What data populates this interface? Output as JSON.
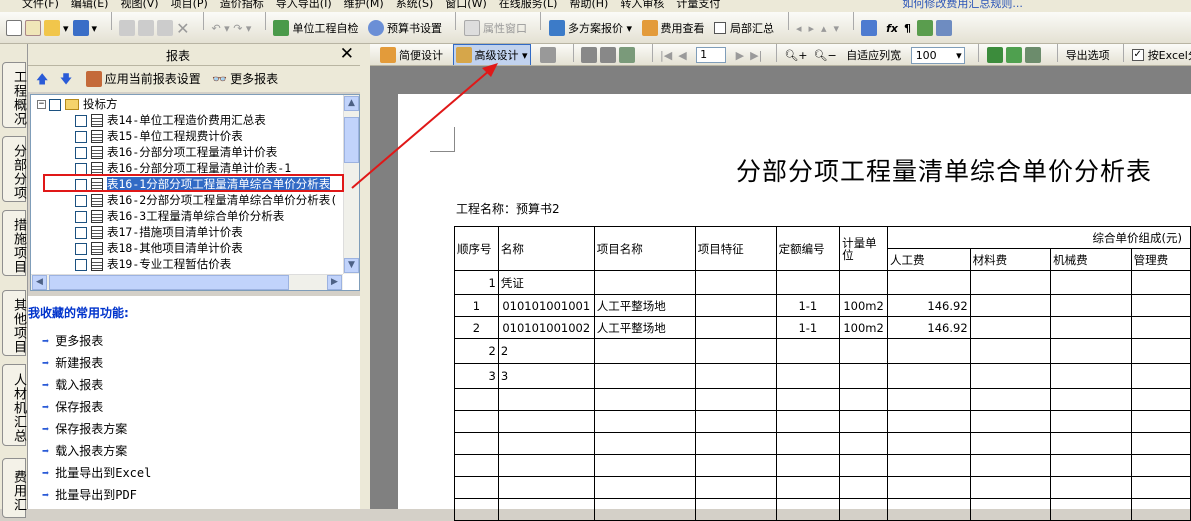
{
  "menu": [
    "文件(F)",
    "编辑(E)",
    "视图(V)",
    "项目(P)",
    "造价指标",
    "导入导出(I)",
    "维护(M)",
    "系统(S)",
    "窗口(W)",
    "在线服务(L)",
    "帮助(H)",
    "转入审核",
    "计量支付",
    "如何修改费用汇总规则..."
  ],
  "toolbar": {
    "self_check": "单位工程自检",
    "budget_settings": "预算书设置",
    "property_window": "属性窗口",
    "multi_plan": "多方案报价",
    "fee_view": "费用查看",
    "partial_summary": "局部汇总"
  },
  "panel": {
    "title": "报表",
    "apply_settings": "应用当前报表设置",
    "more_reports": "更多报表"
  },
  "tree": {
    "root": "投标方",
    "items": [
      "表14-单位工程造价费用汇总表",
      "表15-单位工程规费计价表",
      "表16-分部分项工程量清单计价表",
      "表16-分部分项工程量清单计价表-1",
      "表16-1分部分项工程量清单综合单价分析表",
      "表16-2分部分项工程量清单综合单价分析表(",
      "表16-3工程量清单综合单价分析表",
      "表17-措施项目清单计价表",
      "表18-其他项目清单计价表",
      "表19-专业工程暂估价表"
    ]
  },
  "vtabs": [
    "工程概况",
    "分部分项",
    "措施项目",
    "其他项目",
    "人材机汇总",
    "费用汇"
  ],
  "favorites": {
    "header": "我收藏的常用功能:",
    "items": [
      "更多报表",
      "新建报表",
      "载入报表",
      "保存报表",
      "保存报表方案",
      "载入报表方案",
      "批量导出到Excel",
      "批量导出到PDF"
    ]
  },
  "toolbar2": {
    "simple_design": "简便设计",
    "advanced_design": "高级设计",
    "page": "1",
    "fit_width": "自适应列宽",
    "zoom": "100",
    "export_options": "导出选项",
    "excel_paging": "按Excel分页"
  },
  "report": {
    "title": "分部分项工程量清单综合单价分析表",
    "project": "工程名称：预算书2",
    "headers": {
      "seq": "顺序号",
      "name": "名称",
      "item_name": "项目名称",
      "feature": "项目特征",
      "quota": "定额编号",
      "unit": "计量单位",
      "composition": "综合单价组成(元)",
      "labor": "人工费",
      "material": "材料费",
      "machine": "机械费",
      "mgmt": "管理费"
    },
    "rows": [
      {
        "seq": "1",
        "name": "凭证",
        "item": "",
        "quota": "",
        "unit": "",
        "labor": ""
      },
      {
        "seq": "1",
        "name": "010101001001",
        "item": "人工平整场地",
        "quota": "1-1",
        "unit": "100m2",
        "labor": "146.92"
      },
      {
        "seq": "2",
        "name": "010101001002",
        "item": "人工平整场地",
        "quota": "1-1",
        "unit": "100m2",
        "labor": "146.92"
      },
      {
        "seq": "2",
        "name": "2",
        "item": "",
        "quota": "",
        "unit": "",
        "labor": ""
      },
      {
        "seq": "3",
        "name": "3",
        "item": "",
        "quota": "",
        "unit": "",
        "labor": ""
      }
    ]
  }
}
